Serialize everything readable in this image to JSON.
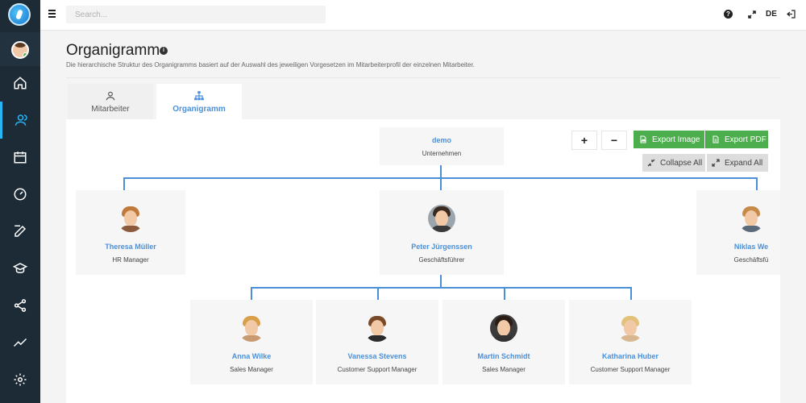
{
  "topbar": {
    "search_placeholder": "Search...",
    "help": "?",
    "lang": "DE"
  },
  "page": {
    "title": "Organigramm",
    "info": "i",
    "subtitle": "Die hierarchische Struktur des Organigramms basiert auf der Auswahl des jeweiligen Vorgesetzen im Mitarbeiterprofil der einzelnen Mitarbeiter."
  },
  "tabs": [
    {
      "label": "Mitarbeiter"
    },
    {
      "label": "Organigramm"
    }
  ],
  "controls": {
    "zoom_in": "+",
    "zoom_out": "−",
    "export_image": "Export Image",
    "export_pdf": "Export PDF",
    "collapse_all": "Collapse All",
    "expand_all": "Expand All"
  },
  "org": {
    "root": {
      "name": "demo",
      "role": "Unternehmen"
    },
    "level1": [
      {
        "name": "Theresa Müller",
        "role": "HR Manager",
        "hair": "#c07a3a",
        "body": "#8b5a3c"
      },
      {
        "name": "Peter Jürgenssen",
        "role": "Geschäftsführer",
        "hair": "#3b2a20",
        "body": "#3a3a3a",
        "bg": "#9aa5ad"
      },
      {
        "name": "Niklas We",
        "role": "Geschäftsfü",
        "hair": "#c68a4a",
        "body": "#5a6a7a"
      }
    ],
    "level2": [
      {
        "name": "Anna Wilke",
        "role": "Sales Manager",
        "hair": "#d9a04a",
        "body": "#c79a70"
      },
      {
        "name": "Vanessa Stevens",
        "role": "Customer Support Manager",
        "hair": "#7a4a28",
        "body": "#2b2b2b"
      },
      {
        "name": "Martin Schmidt",
        "role": "Sales Manager",
        "hair": "#2b1d16",
        "body": "#333",
        "bg": "#3b3b3b"
      },
      {
        "name": "Katharina Huber",
        "role": "Customer Support Manager",
        "hair": "#e2c27a",
        "body": "#d8b890"
      }
    ]
  }
}
